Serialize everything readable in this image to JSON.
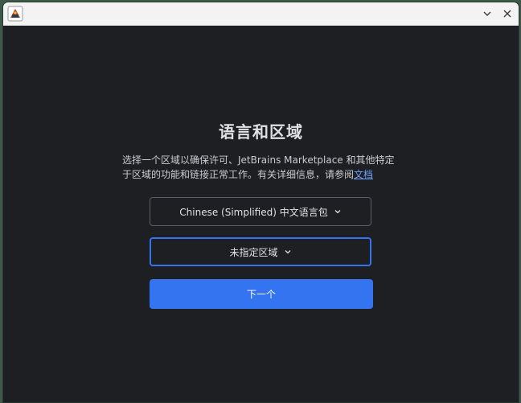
{
  "window": {
    "minimize_icon": "chevron-down-icon",
    "close_icon": "close-icon"
  },
  "main": {
    "heading": "语言和区域",
    "description_text": "选择一个区域以确保许可、JetBrains Marketplace 和其他特定于区域的功能和链接正常工作。有关详细信息，请参阅",
    "doc_link": "文档",
    "language_select": {
      "value": "Chinese (Simplified) 中文语言包"
    },
    "region_select": {
      "value": "未指定区域"
    },
    "next_button": "下一个"
  },
  "colors": {
    "background": "#1e1f22",
    "accent": "#3574f0",
    "link": "#6d9eff",
    "text": "#dfe1e5"
  }
}
